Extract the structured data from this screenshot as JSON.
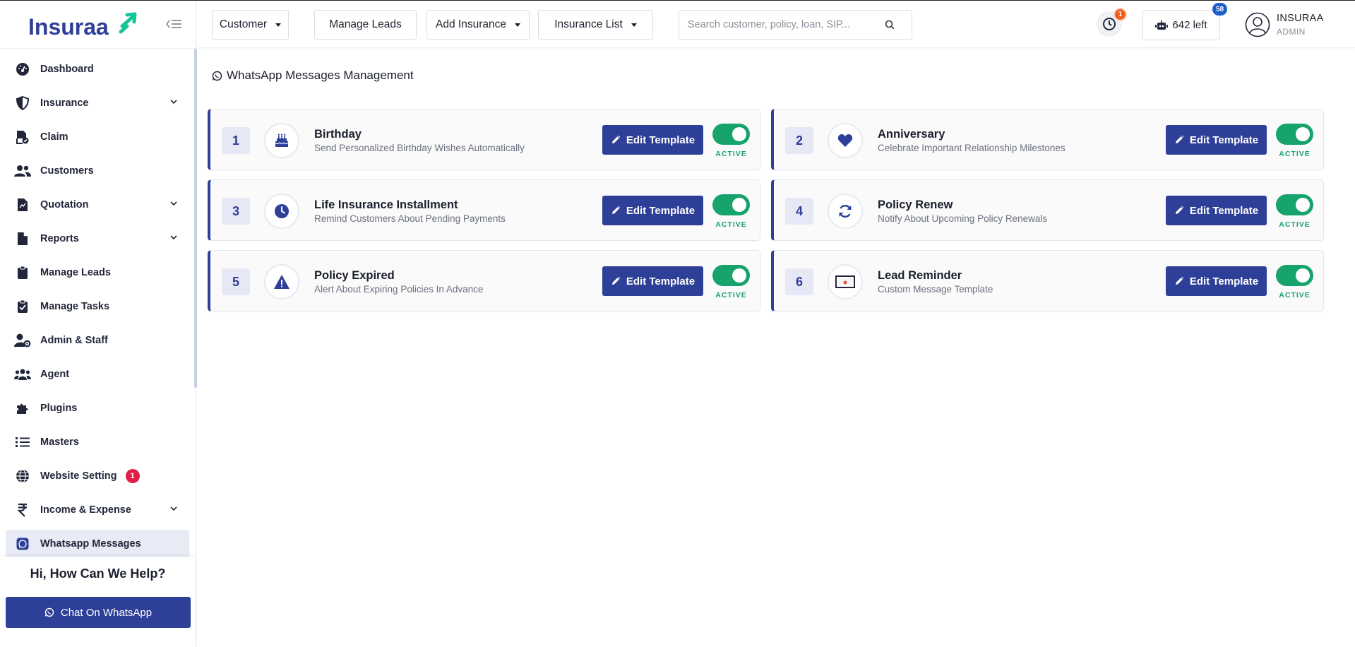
{
  "brand": {
    "name": "Insuraa",
    "colors": {
      "primary": "#2e3f98",
      "accent": "#17c49a",
      "active": "#17a36c",
      "badge": "#e11d48"
    }
  },
  "sidebar": {
    "items": [
      {
        "label": "Dashboard",
        "icon": "gauge-icon",
        "has_submenu": false
      },
      {
        "label": "Insurance",
        "icon": "shield-icon",
        "has_submenu": true
      },
      {
        "label": "Claim",
        "icon": "file-check-icon",
        "has_submenu": false
      },
      {
        "label": "Customers",
        "icon": "users-icon",
        "has_submenu": false
      },
      {
        "label": "Quotation",
        "icon": "file-invoice-icon",
        "has_submenu": true
      },
      {
        "label": "Reports",
        "icon": "file-icon",
        "has_submenu": true
      },
      {
        "label": "Manage Leads",
        "icon": "clipboard-icon",
        "has_submenu": false
      },
      {
        "label": "Manage Tasks",
        "icon": "clipboard-check-icon",
        "has_submenu": false
      },
      {
        "label": "Admin & Staff",
        "icon": "user-gear-icon",
        "has_submenu": false
      },
      {
        "label": "Agent",
        "icon": "people-group-icon",
        "has_submenu": false
      },
      {
        "label": "Plugins",
        "icon": "puzzle-icon",
        "has_submenu": false
      },
      {
        "label": "Masters",
        "icon": "list-icon",
        "has_submenu": false
      },
      {
        "label": "Website Setting",
        "icon": "globe-icon",
        "has_submenu": false,
        "badge": "1"
      },
      {
        "label": "Income & Expense",
        "icon": "rupee-icon",
        "has_submenu": true
      },
      {
        "label": "Whatsapp Messages",
        "icon": "whatsapp-icon",
        "has_submenu": false,
        "active": true
      }
    ],
    "help_title": "Hi, How Can We Help?",
    "chat_button": "Chat On WhatsApp"
  },
  "header": {
    "buttons": [
      {
        "label": "Customer",
        "dropdown": true
      },
      {
        "label": "Manage Leads",
        "dropdown": false
      },
      {
        "label": "Add Insurance",
        "dropdown": true
      },
      {
        "label": "Insurance List",
        "dropdown": true
      }
    ],
    "search_placeholder": "Search customer, policy, loan, SIP...",
    "notifications_count": "1",
    "credits_label": "642 left",
    "credits_badge": "58",
    "user_name": "INSURAA",
    "user_role": "ADMIN"
  },
  "main": {
    "title": "WhatsApp Messages Management",
    "edit_label": "Edit Template",
    "templates": [
      {
        "number": "1",
        "title": "Birthday",
        "subtitle": "Send Personalized Birthday Wishes Automatically",
        "icon": "birthday-cake-icon",
        "status": "ACTIVE",
        "enabled": true
      },
      {
        "number": "2",
        "title": "Anniversary",
        "subtitle": "Celebrate Important Relationship Milestones",
        "icon": "heart-icon",
        "status": "ACTIVE",
        "enabled": true
      },
      {
        "number": "3",
        "title": "Life Insurance Installment",
        "subtitle": "Remind Customers About Pending Payments",
        "icon": "clock-icon",
        "status": "ACTIVE",
        "enabled": true
      },
      {
        "number": "4",
        "title": "Policy Renew",
        "subtitle": "Notify About Upcoming Policy Renewals",
        "icon": "refresh-icon",
        "status": "ACTIVE",
        "enabled": true
      },
      {
        "number": "5",
        "title": "Policy Expired",
        "subtitle": "Alert About Expiring Policies In Advance",
        "icon": "warning-icon",
        "status": "ACTIVE",
        "enabled": true
      },
      {
        "number": "6",
        "title": "Lead Reminder",
        "subtitle": "Custom Message Template",
        "icon": "reminder-screen-icon",
        "status": "ACTIVE",
        "enabled": true
      }
    ]
  }
}
